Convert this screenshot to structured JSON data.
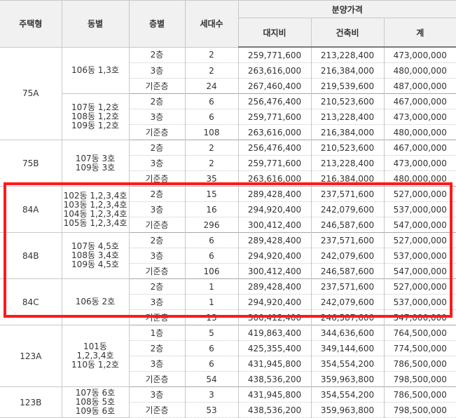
{
  "header": {
    "type": "주택형",
    "building": "동별",
    "floor": "층별",
    "units": "세대수",
    "price_group": "분양가격",
    "land": "대지비",
    "construction": "건축비",
    "total": "계"
  },
  "groups": [
    {
      "type": "75A",
      "subgroups": [
        {
          "buildings": [
            "106동 1,3호"
          ],
          "rows": [
            {
              "floor": "2층",
              "units": "2",
              "land": "259,771,600",
              "construction": "213,228,400",
              "total": "473,000,000"
            },
            {
              "floor": "3층",
              "units": "2",
              "land": "263,616,000",
              "construction": "216,384,000",
              "total": "480,000,000"
            },
            {
              "floor": "기준층",
              "units": "24",
              "land": "267,460,400",
              "construction": "219,539,600",
              "total": "487,000,000"
            }
          ]
        },
        {
          "buildings": [
            "107동 1,2호",
            "108동 1,2호",
            "109동 1,2호"
          ],
          "rows": [
            {
              "floor": "2층",
              "units": "6",
              "land": "256,476,400",
              "construction": "210,523,600",
              "total": "467,000,000"
            },
            {
              "floor": "3층",
              "units": "6",
              "land": "259,771,600",
              "construction": "213,228,400",
              "total": "473,000,000"
            },
            {
              "floor": "기준층",
              "units": "108",
              "land": "263,616,000",
              "construction": "216,384,000",
              "total": "480,000,000"
            }
          ]
        }
      ]
    },
    {
      "type": "75B",
      "subgroups": [
        {
          "buildings": [
            "107동 3호",
            "109동 3호"
          ],
          "rows": [
            {
              "floor": "2층",
              "units": "2",
              "land": "256,476,400",
              "construction": "210,523,600",
              "total": "467,000,000"
            },
            {
              "floor": "3층",
              "units": "2",
              "land": "259,771,600",
              "construction": "213,228,400",
              "total": "473,000,000"
            },
            {
              "floor": "기준층",
              "units": "35",
              "land": "263,616,000",
              "construction": "216,384,000",
              "total": "480,000,000"
            }
          ]
        }
      ]
    },
    {
      "type": "84A",
      "subgroups": [
        {
          "buildings": [
            "102동 1,2,3,4호",
            "103동 1,2,3,4호",
            "104동 1,2,3,4호",
            "105동 1,2,3,4호"
          ],
          "rows": [
            {
              "floor": "2층",
              "units": "15",
              "land": "289,428,400",
              "construction": "237,571,600",
              "total": "527,000,000"
            },
            {
              "floor": "3층",
              "units": "16",
              "land": "294,920,400",
              "construction": "242,079,600",
              "total": "537,000,000"
            },
            {
              "floor": "기준층",
              "units": "296",
              "land": "300,412,400",
              "construction": "246,587,600",
              "total": "547,000,000"
            }
          ]
        }
      ]
    },
    {
      "type": "84B",
      "subgroups": [
        {
          "buildings": [
            "107동 4,5호",
            "108동 3,4호",
            "109동 4,5호"
          ],
          "rows": [
            {
              "floor": "2층",
              "units": "6",
              "land": "289,428,400",
              "construction": "237,571,600",
              "total": "527,000,000"
            },
            {
              "floor": "3층",
              "units": "6",
              "land": "294,920,400",
              "construction": "242,079,600",
              "total": "537,000,000"
            },
            {
              "floor": "기준층",
              "units": "106",
              "land": "300,412,400",
              "construction": "246,587,600",
              "total": "547,000,000"
            }
          ]
        }
      ]
    },
    {
      "type": "84C",
      "subgroups": [
        {
          "buildings": [
            "106동 2호"
          ],
          "rows": [
            {
              "floor": "2층",
              "units": "1",
              "land": "289,428,400",
              "construction": "237,571,600",
              "total": "527,000,000"
            },
            {
              "floor": "3층",
              "units": "1",
              "land": "294,920,400",
              "construction": "242,079,600",
              "total": "537,000,000"
            },
            {
              "floor": "기준층",
              "units": "13",
              "land": "300,412,400",
              "construction": "246,587,600",
              "total": "547,000,000"
            }
          ]
        }
      ]
    },
    {
      "type": "123A",
      "subgroups": [
        {
          "buildings": [
            "101동",
            "1,2,3,4호",
            "110동 1,2호"
          ],
          "rows": [
            {
              "floor": "1층",
              "units": "5",
              "land": "419,863,400",
              "construction": "344,636,600",
              "total": "764,500,000"
            },
            {
              "floor": "2층",
              "units": "6",
              "land": "425,355,400",
              "construction": "349,144,600",
              "total": "774,500,000"
            },
            {
              "floor": "3층",
              "units": "6",
              "land": "431,945,800",
              "construction": "354,554,200",
              "total": "786,500,000"
            },
            {
              "floor": "기준층",
              "units": "54",
              "land": "438,536,200",
              "construction": "359,963,800",
              "total": "798,500,000"
            }
          ]
        }
      ]
    },
    {
      "type": "123B",
      "subgroups": [
        {
          "buildings": [
            "107동 6호",
            "108동 5호",
            "109동 6호"
          ],
          "rows": [
            {
              "floor": "3층",
              "units": "3",
              "land": "431,945,800",
              "construction": "354,554,200",
              "total": "786,500,000"
            },
            {
              "floor": "기준층",
              "units": "53",
              "land": "438,536,200",
              "construction": "359,963,800",
              "total": "798,500,000"
            }
          ]
        }
      ]
    }
  ],
  "highlight": {
    "color": "#ff1a1a",
    "groups": [
      "84A",
      "84B",
      "84C"
    ]
  },
  "colors": {
    "header_bg": "#f1f1f1",
    "border": "#c8c8c8",
    "text": "#333333"
  }
}
